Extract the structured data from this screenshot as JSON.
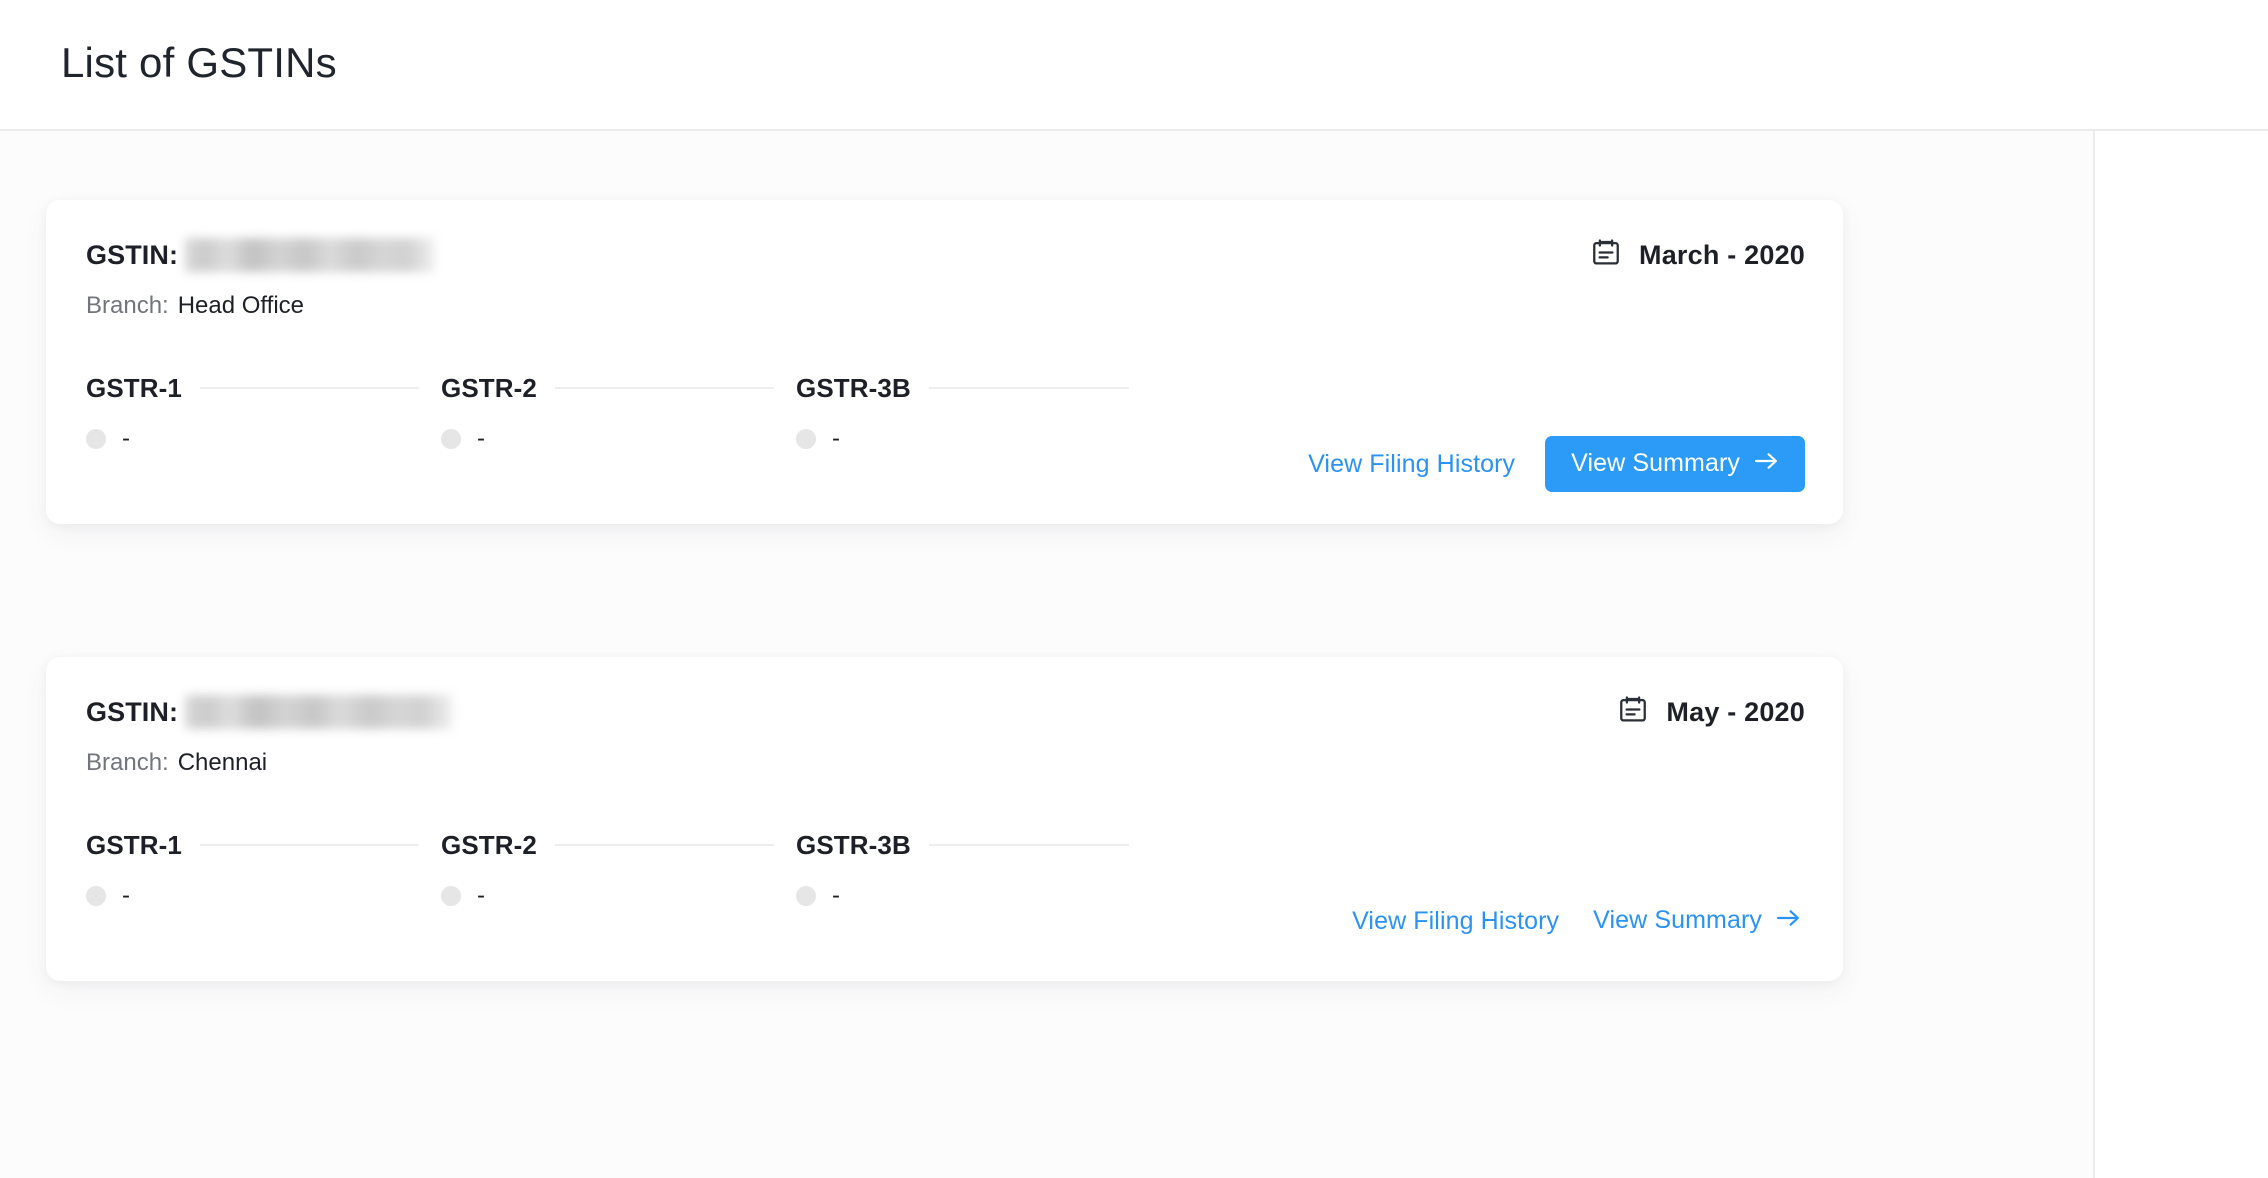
{
  "header": {
    "title": "List of GSTINs"
  },
  "colors": {
    "accent_blue": "#2b9bf7",
    "link_blue": "#2b92f5",
    "text_dark": "#1d2026",
    "text_muted": "#72767c",
    "pane_background": "#fcfcfc",
    "card_background": "#ffffff",
    "rule_gray": "#eceef0",
    "status_dot_gray": "#e6e6e6"
  },
  "labels": {
    "gstin_label": "GSTIN:",
    "branch_label": "Branch:",
    "gstin_value_redacted": "",
    "calendar_icon": "notepad-calendar-icon",
    "arrow_icon": "arrow-right-icon",
    "status_dot_icon": "status-dot-icon"
  },
  "cards": [
    {
      "gstin_label": "GSTIN:",
      "gstin_value": "",
      "branch_label": "Branch:",
      "branch_value": "Head Office",
      "period": "March - 2020",
      "returns": [
        {
          "name": "GSTR-1",
          "status": "-"
        },
        {
          "name": "GSTR-2",
          "status": "-"
        },
        {
          "name": "GSTR-3B",
          "status": "-"
        }
      ],
      "actions": {
        "filing_history": "View Filing History",
        "view_summary": "View Summary",
        "summary_style": "primary"
      }
    },
    {
      "gstin_label": "GSTIN:",
      "gstin_value": "",
      "branch_label": "Branch:",
      "branch_value": "Chennai",
      "period": "May - 2020",
      "returns": [
        {
          "name": "GSTR-1",
          "status": "-"
        },
        {
          "name": "GSTR-2",
          "status": "-"
        },
        {
          "name": "GSTR-3B",
          "status": "-"
        }
      ],
      "actions": {
        "filing_history": "View Filing History",
        "view_summary": "View Summary",
        "summary_style": "link"
      }
    }
  ]
}
